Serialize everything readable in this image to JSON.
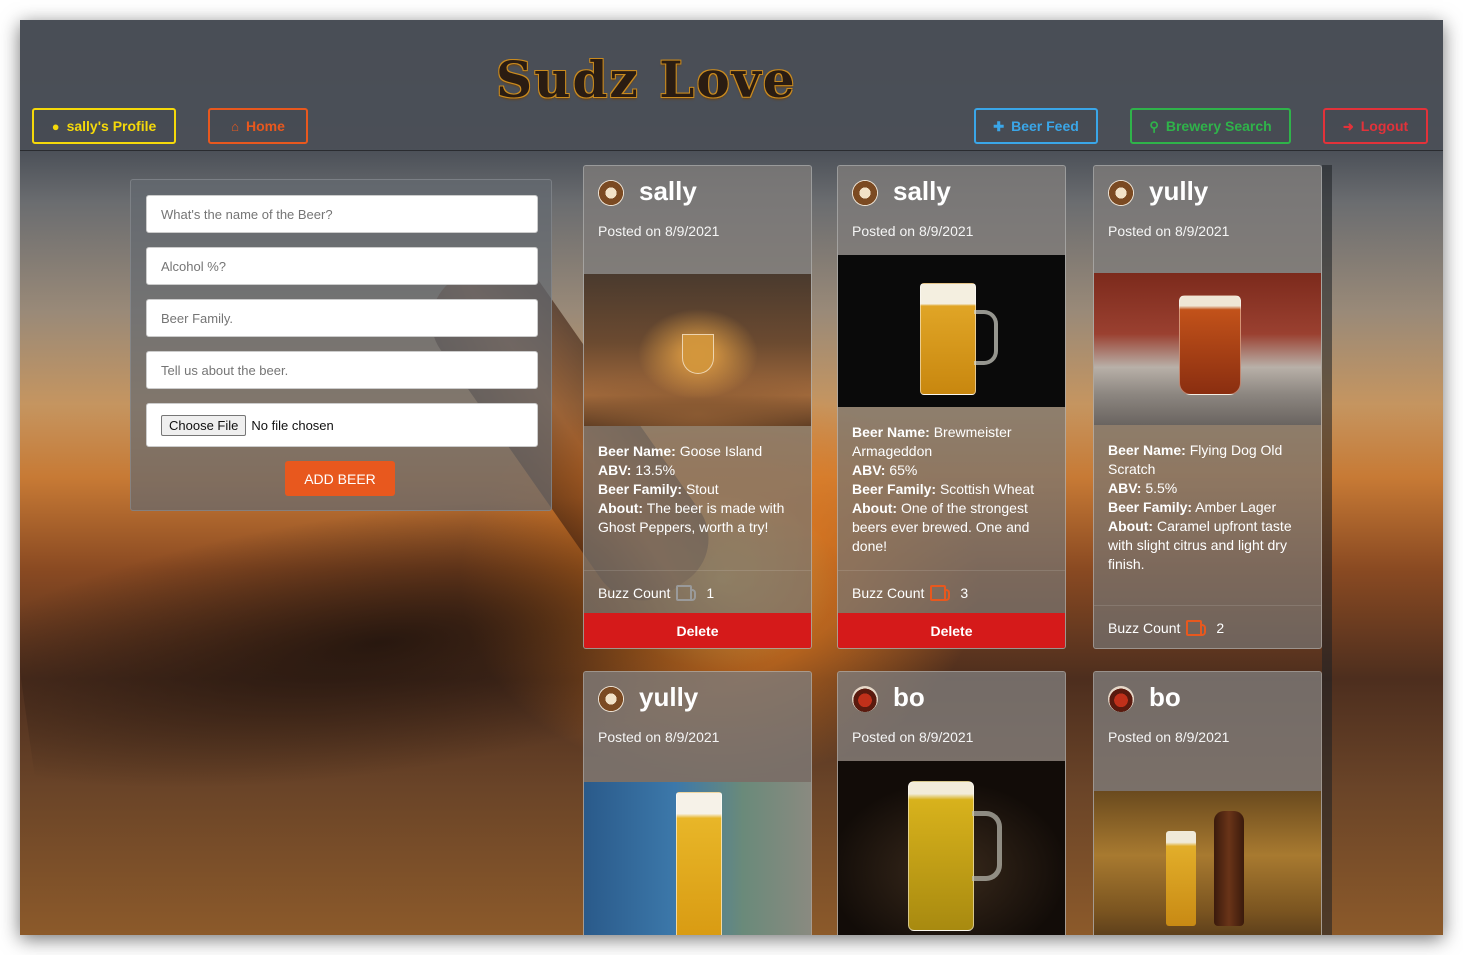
{
  "app": {
    "logo_text": "Sudz Love"
  },
  "nav": {
    "profile": {
      "label": "sally's Profile",
      "icon": "user-circle-icon",
      "color": "#f5d90a"
    },
    "home": {
      "label": "Home",
      "icon": "home-icon",
      "color": "#e8581e"
    },
    "beer_feed": {
      "label": "Beer Feed",
      "icon": "plus-icon",
      "color": "#3aa6e8"
    },
    "brewery_search": {
      "label": "Brewery Search",
      "icon": "search-icon",
      "color": "#2fb34a"
    },
    "logout": {
      "label": "Logout",
      "icon": "sign-out-icon",
      "color": "#e2323a"
    }
  },
  "form": {
    "name_placeholder": "What's the name of the Beer?",
    "alcohol_placeholder": "Alcohol %?",
    "family_placeholder": "Beer Family.",
    "about_placeholder": "Tell us about the beer.",
    "file_button": "Choose File",
    "file_status": "No file chosen",
    "submit_label": "ADD BEER"
  },
  "labels": {
    "beer_name": "Beer Name:",
    "abv": "ABV:",
    "beer_family": "Beer Family:",
    "about": "About:",
    "buzz_count": "Buzz Count",
    "delete": "Delete"
  },
  "posts": [
    {
      "user": "sally",
      "posted": "Posted on 8/9/2021",
      "beer_name": "Goose Island",
      "abv": "13.5%",
      "family": "Stout",
      "about": "The beer is made with Ghost Peppers, worth a try!",
      "buzz": "1",
      "buzz_icon_color": "#9a9a9a"
    },
    {
      "user": "sally",
      "posted": "Posted on 8/9/2021",
      "beer_name": "Brewmeister Armageddon",
      "abv": "65%",
      "family": "Scottish Wheat",
      "about": "One of the strongest beers ever brewed. One and done!",
      "buzz": "3",
      "buzz_icon_color": "#e8581e"
    },
    {
      "user": "yully",
      "posted": "Posted on 8/9/2021",
      "beer_name": "Flying Dog Old Scratch",
      "abv": "5.5%",
      "family": "Amber Lager",
      "about": "Caramel upfront taste with slight citrus and light dry finish.",
      "buzz": "2",
      "buzz_icon_color": "#e8581e"
    },
    {
      "user": "yully",
      "posted": "Posted on 8/9/2021"
    },
    {
      "user": "bo",
      "posted": "Posted on 8/9/2021"
    },
    {
      "user": "bo",
      "posted": "Posted on 8/9/2021"
    }
  ]
}
